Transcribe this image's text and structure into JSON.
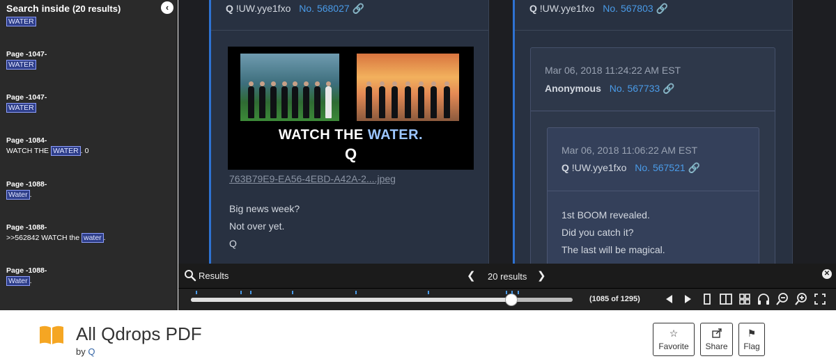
{
  "search_panel": {
    "title": "Search inside",
    "count_text": "(20 results)",
    "top_hit": "WATER",
    "results": [
      {
        "page": "Page -1047-",
        "before": "",
        "hit": "WATER",
        "after": ""
      },
      {
        "page": "Page -1047-",
        "before": "",
        "hit": "WATER",
        "after": ""
      },
      {
        "page": "Page -1084-",
        "before": "WATCH THE ",
        "hit": "WATER",
        "after": ". 0"
      },
      {
        "page": "Page -1088-",
        "before": "",
        "hit": "Water",
        "after": "."
      },
      {
        "page": "Page -1088-",
        "before": ">>562842 WATCH the ",
        "hit": "water",
        "after": "."
      },
      {
        "page": "Page -1088-",
        "before": "",
        "hit": "Water",
        "after": "."
      }
    ]
  },
  "post_left": {
    "name": "Q",
    "trip": "!UW.yye1fxo",
    "postno": "No. 568027",
    "meme_caption_a": "WATCH THE",
    "meme_caption_b": "WATER.",
    "meme_q": "Q",
    "file": "763B79E9-EA56-4EBD-A42A-2....jpeg",
    "lines": [
      "Big news week?",
      "Not over yet.",
      "Q"
    ]
  },
  "post_right": {
    "name": "Q",
    "trip": "!UW.yye1fxo",
    "postno": "No. 567803",
    "quote1": {
      "date": "Mar 06, 2018 11:24:22 AM EST",
      "name": "Anonymous",
      "postno": "No. 567733"
    },
    "quote2": {
      "date": "Mar 06, 2018 11:06:22 AM EST",
      "name": "Q",
      "trip": "!UW.yye1fxo",
      "postno": "No. 567521",
      "lines": [
        "1st BOOM revealed.",
        "Did you catch it?",
        "The last will be magical."
      ]
    }
  },
  "results_bar": {
    "label": "Results",
    "count": "20 results"
  },
  "toolbar": {
    "page_indicator": "(1085 of 1295)",
    "slider_fraction": 0.84,
    "tick_fractions": [
      0.013,
      0.13,
      0.155,
      0.265,
      0.43,
      0.62,
      0.825,
      0.84,
      0.855
    ]
  },
  "info": {
    "title": "All Qdrops PDF",
    "by": "by",
    "author": "Q",
    "buttons": [
      {
        "icon": "☆",
        "label": "Favorite"
      },
      {
        "icon": "⮫",
        "label": "Share"
      },
      {
        "icon": "⚑",
        "label": "Flag"
      }
    ]
  },
  "colors": {
    "accent": "#4a9be8",
    "post_bg": "#283141",
    "highlight": "#2e3e8a",
    "book": "#f5a623"
  }
}
